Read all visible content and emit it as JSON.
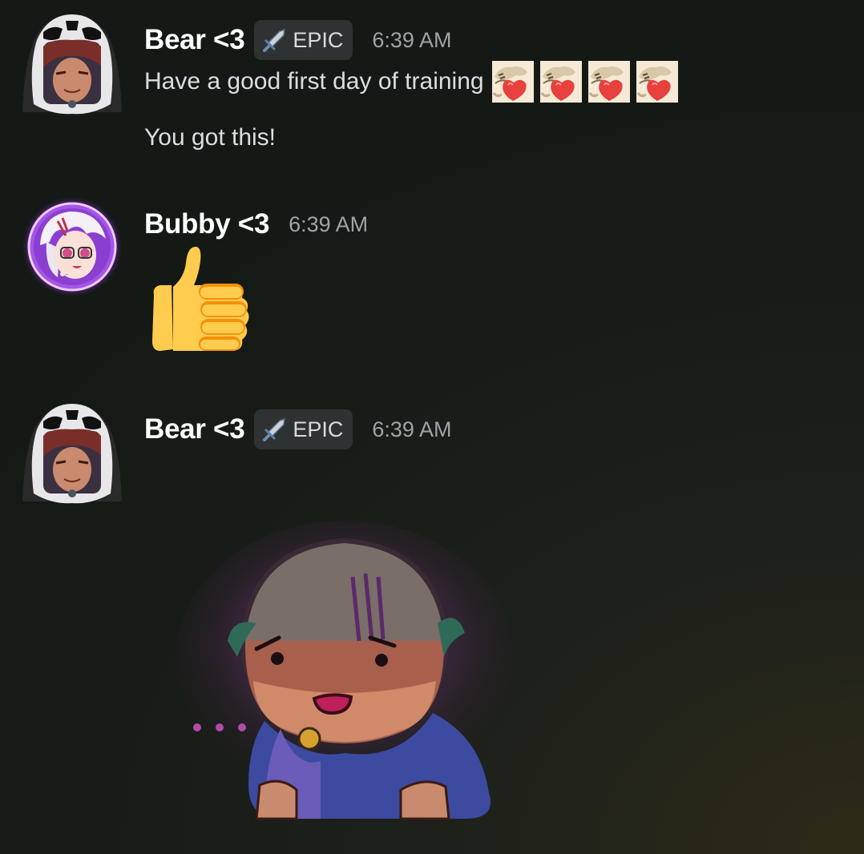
{
  "messages": [
    {
      "username": "Bear <3",
      "tag": {
        "label": "EPIC",
        "icon": "sword-icon"
      },
      "timestamp": "6:39 AM",
      "lines": [
        "Have a good first day of training",
        "You got this!"
      ],
      "emotes": [
        "heart-hug-emote",
        "heart-hug-emote",
        "heart-hug-emote",
        "heart-hug-emote"
      ]
    },
    {
      "username": "Bubby <3",
      "timestamp": "6:39 AM",
      "content": {
        "emoji": "thumbs-up-emoji"
      }
    },
    {
      "username": "Bear <3",
      "tag": {
        "label": "EPIC",
        "icon": "sword-icon"
      },
      "timestamp": "6:39 AM",
      "content": {
        "sticker": "confused-gladiator-sticker",
        "sticker_text": "..."
      }
    }
  ],
  "colors": {
    "username": "#ffffff",
    "message_text": "#dbdee1",
    "timestamp": "#9ea3a8",
    "tag_bg": "#2e3233",
    "background": "#171b17",
    "avatar_ring_purple": "#b44cf2"
  }
}
